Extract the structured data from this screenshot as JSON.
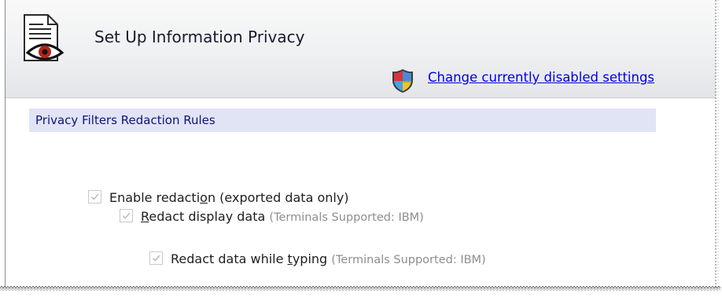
{
  "header": {
    "title": "Set Up Information Privacy",
    "change_link_label": "Change currently disabled settings",
    "icon": "document-eye-icon",
    "shield_icon": "uac-shield-icon"
  },
  "section": {
    "title": "Privacy Filters Redaction Rules"
  },
  "options": [
    {
      "label_pre": "Enable redacti",
      "label_key": "o",
      "label_post": "n",
      "note": "(exported data only)",
      "checked": true,
      "disabled": true
    },
    {
      "label_pre": "",
      "label_key": "R",
      "label_post": "edact display data",
      "note": "(Terminals Supported:  IBM)",
      "checked": true,
      "disabled": true
    },
    {
      "label_pre": "Redact data while ",
      "label_key": "t",
      "label_post": "yping",
      "note": "(Terminals Supported:  IBM)",
      "checked": true,
      "disabled": true
    }
  ],
  "colors": {
    "link": "#0000e0",
    "section_header_bg": "#e1e4f5",
    "section_header_text": "#10127a",
    "note_text": "#8e8e8e"
  }
}
